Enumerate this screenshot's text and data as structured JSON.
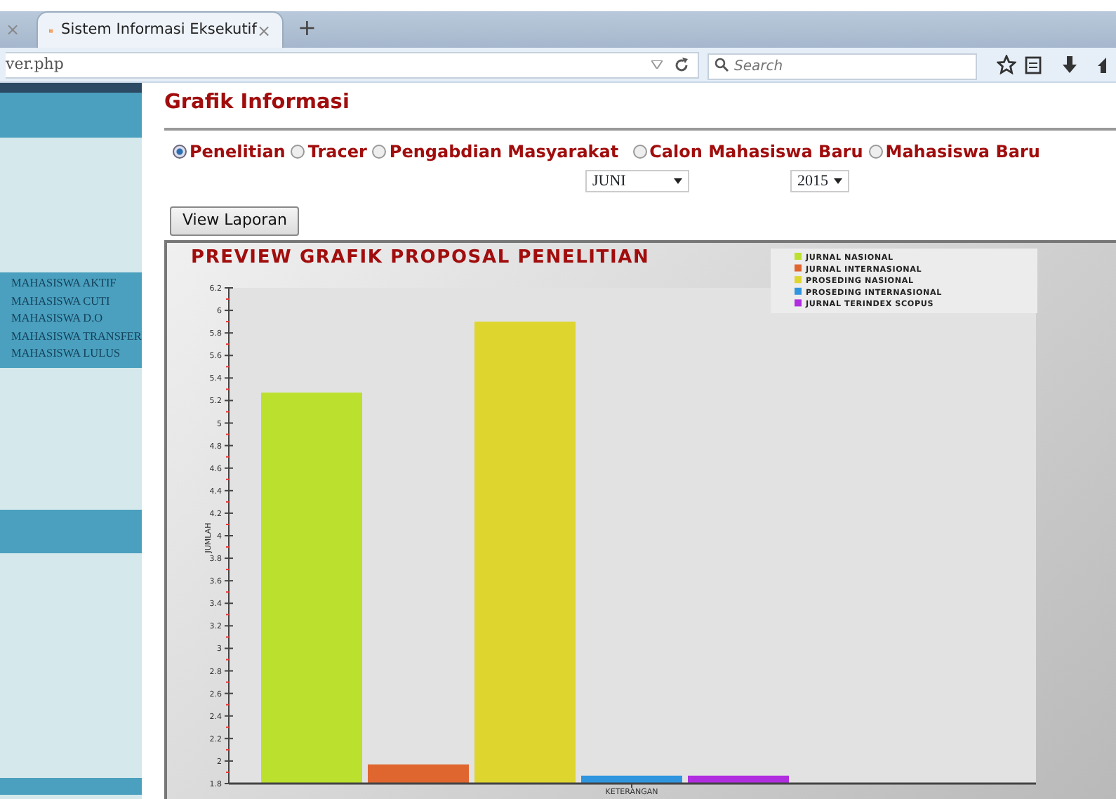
{
  "browser": {
    "tabs": [
      {
        "close": "×",
        "selected": false
      },
      {
        "title": "Sistem Informasi Eksekutif",
        "close": "×",
        "selected": true
      }
    ],
    "new_tab": "+",
    "address": "ver.php",
    "search": {
      "placeholder": "Search"
    }
  },
  "sidebar": {
    "items": [
      {
        "label": "MAHASISWA AKTIF"
      },
      {
        "label": "MAHASISWA CUTI"
      },
      {
        "label": "MAHASISWA D.O"
      },
      {
        "label": "MAHASISWA TRANSFER"
      },
      {
        "label": "MAHASISWA LULUS"
      }
    ]
  },
  "heading": "Grafik Informasi",
  "report_types": [
    {
      "label": "Penelitian",
      "selected": true
    },
    {
      "label": "Tracer",
      "selected": false
    },
    {
      "label": "Pengabdian Masyarakat",
      "selected": false
    },
    {
      "label": "Calon Mahasiswa Baru",
      "selected": false
    },
    {
      "label": "Mahasiswa Baru",
      "selected": false
    }
  ],
  "month": "JUNI",
  "year": "2015",
  "button": "View Laporan",
  "chart": {
    "chart_data": {
      "type": "bar",
      "title": "PREVIEW GRAFIK PROPOSAL PENELITIAN",
      "ylabel": "JUMLAH",
      "categories": [
        "KETERANGAN"
      ],
      "legend": "top-right",
      "series": [
        {
          "name": "JURNAL NASIONAL",
          "color": "#bbe02e",
          "values": [
            5.27
          ]
        },
        {
          "name": "JURNAL INTERNASIONAL",
          "color": "#e06630",
          "values": [
            1.97
          ]
        },
        {
          "name": "PROSEDING NASIONAL",
          "color": "#ded52e",
          "values": [
            5.9
          ]
        },
        {
          "name": "PROSEDING INTERNASIONAL",
          "color": "#2f95df",
          "values": [
            1.87
          ]
        },
        {
          "name": "JURNAL TERINDEX SCOPUS",
          "color": "#b02edf",
          "values": [
            1.87
          ]
        }
      ],
      "ylim": [
        1.8,
        6.2
      ],
      "yticks": [
        1.8,
        2,
        2.2,
        2.4,
        2.6,
        2.8,
        3,
        3.2,
        3.4,
        3.6,
        3.8,
        4,
        4.2,
        4.4,
        4.6,
        4.8,
        5,
        5.2,
        5.4,
        5.6,
        5.8,
        6,
        6.2
      ]
    }
  }
}
